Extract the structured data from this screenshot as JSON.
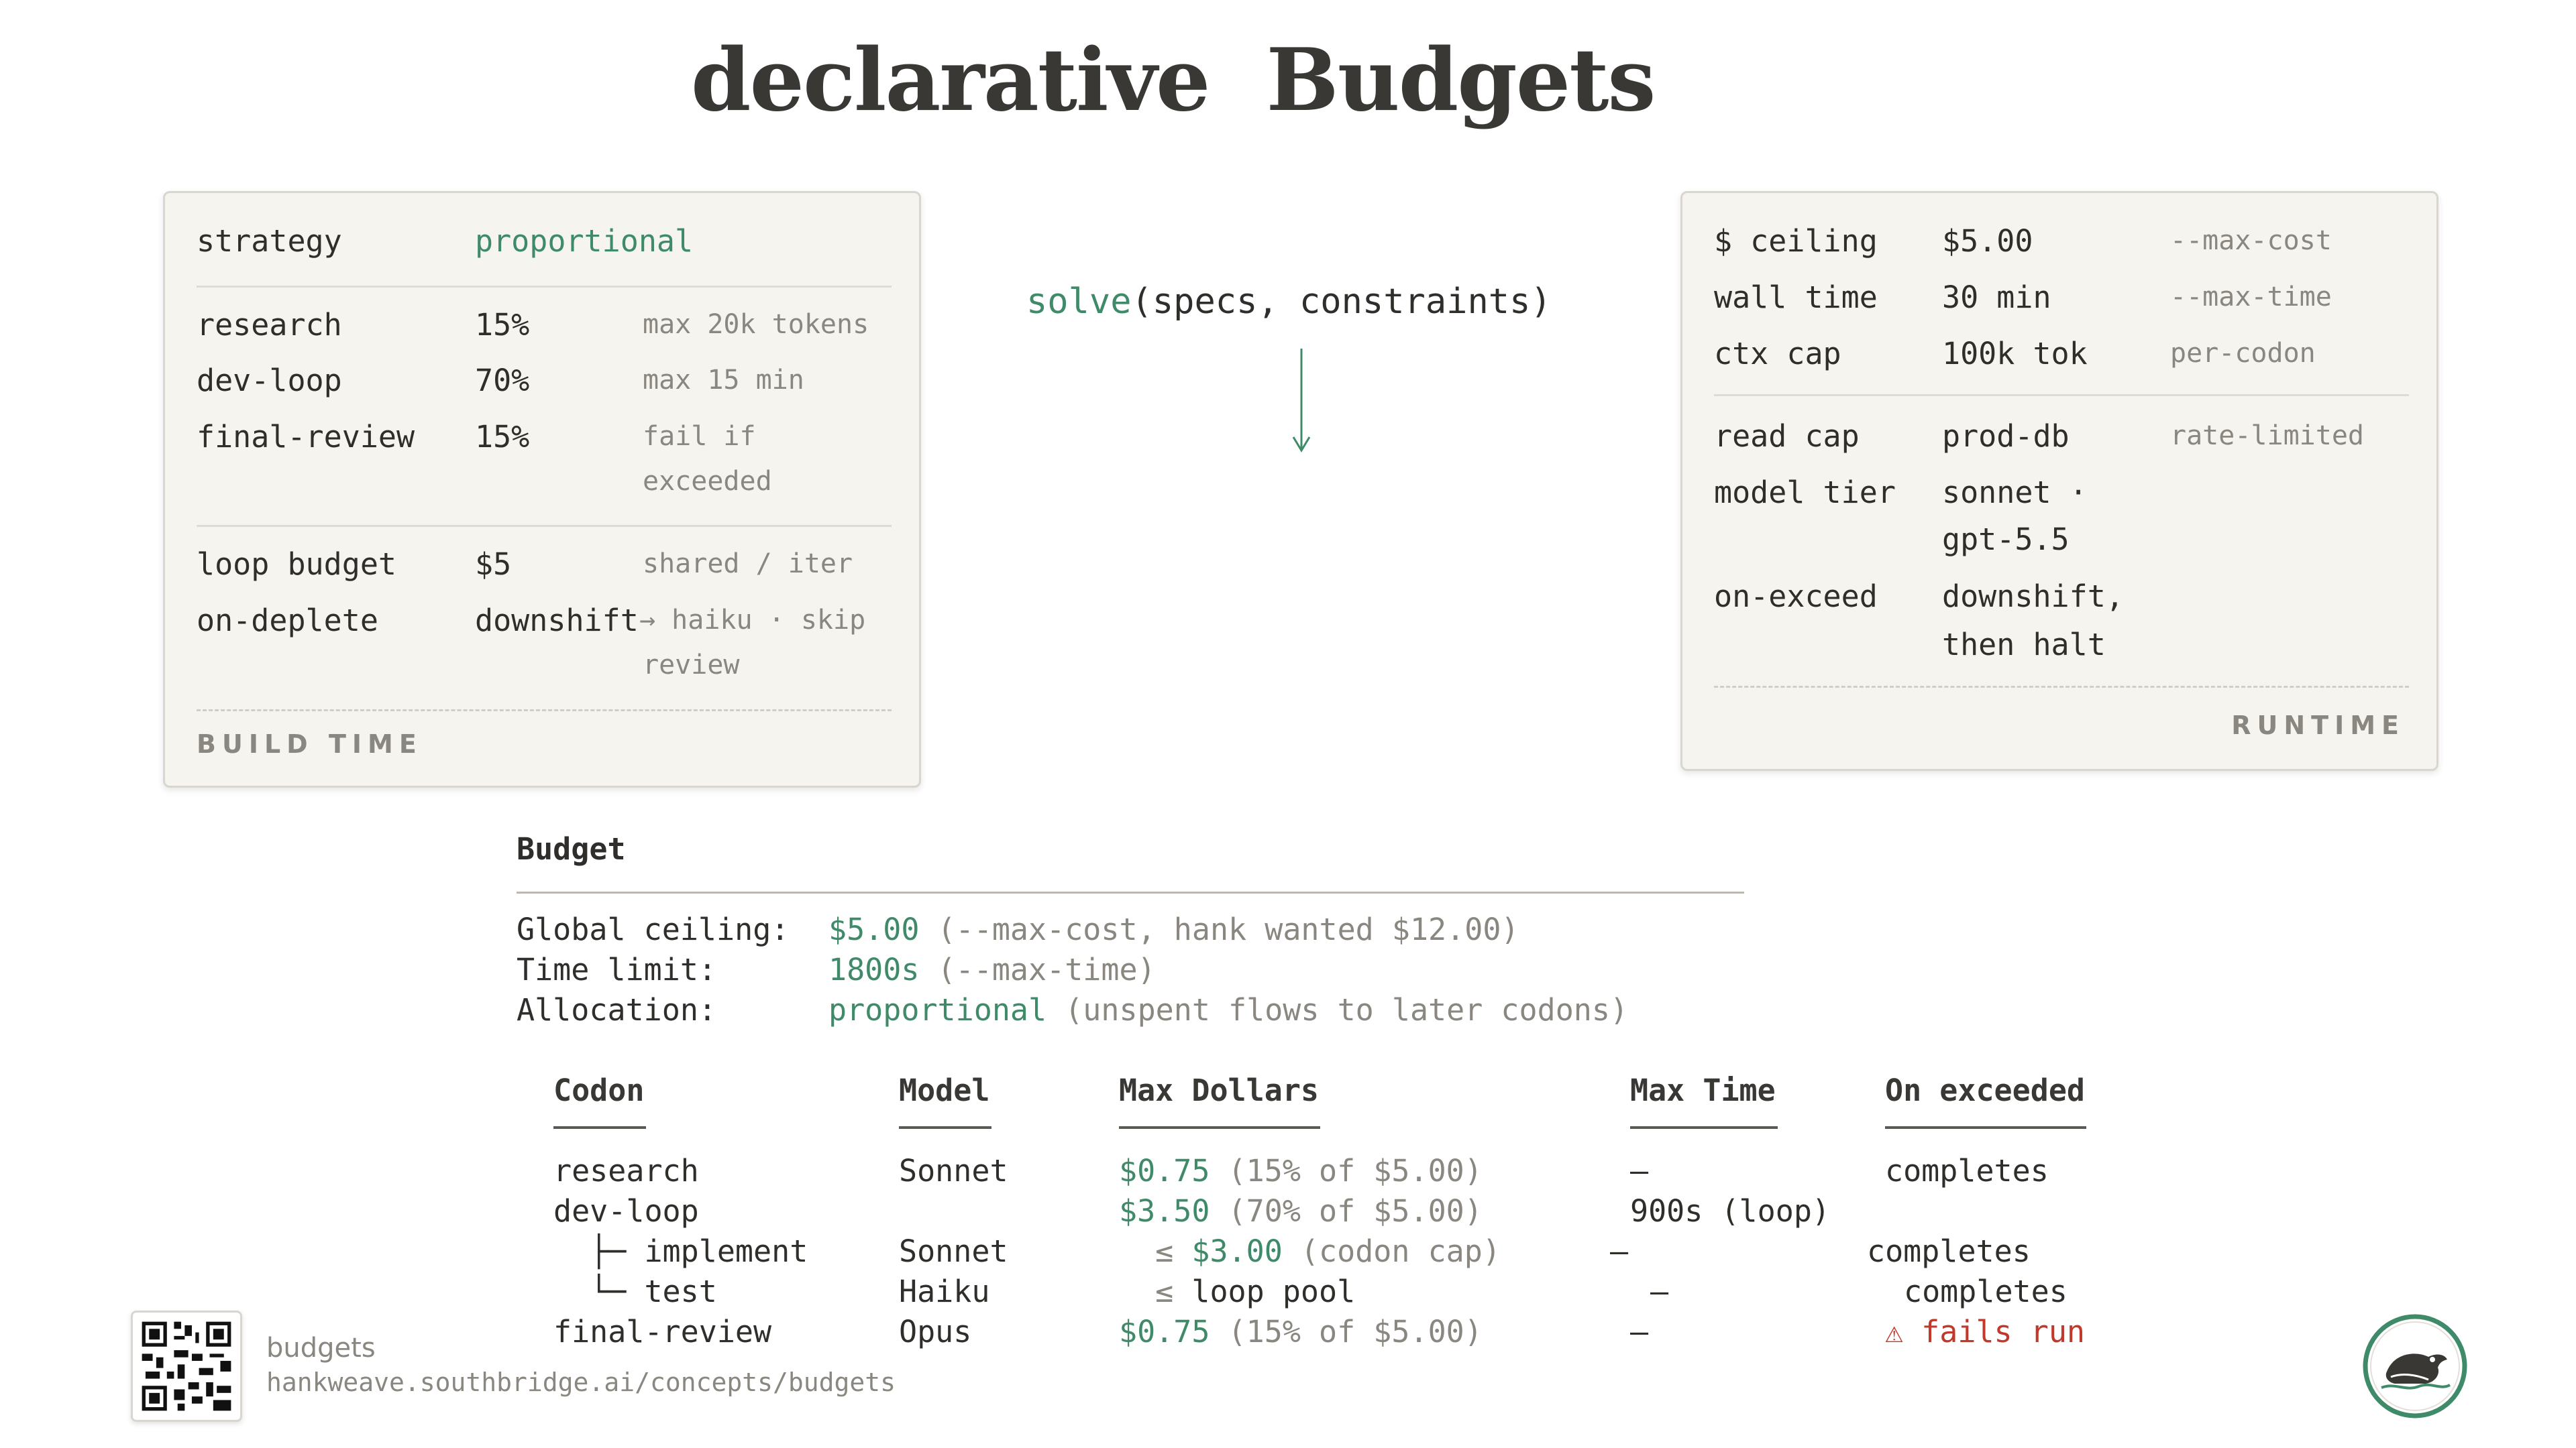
{
  "title": "declarative  Budgets",
  "build_panel": {
    "strategy_key": "strategy",
    "strategy_value": "proportional",
    "rows": [
      {
        "key": "research",
        "value": "15%",
        "note": "max 20k tokens"
      },
      {
        "key": "dev-loop",
        "value": "70%",
        "note": "max 15 min"
      },
      {
        "key": "final-review",
        "value": "15%",
        "note": "fail if",
        "note2": "exceeded"
      }
    ],
    "loop_budget": {
      "key": "loop budget",
      "value": "$5",
      "note": "shared / iter"
    },
    "on_deplete": {
      "key": "on-deplete",
      "value": "downshift",
      "note": "→ haiku · skip",
      "note2": "review"
    },
    "caption": "BUILD TIME"
  },
  "solve": {
    "fn": "solve",
    "args": "(specs, constraints)"
  },
  "runtime_panel": {
    "rows1": [
      {
        "key": "$ ceiling",
        "value": "$5.00",
        "note": "--max-cost"
      },
      {
        "key": "wall time",
        "value": "30 min",
        "note": "--max-time"
      },
      {
        "key": "ctx cap",
        "value": "100k tok",
        "note": "per-codon"
      }
    ],
    "read_cap": {
      "key": "read cap",
      "value": "prod-db",
      "note": "rate-limited"
    },
    "model_tier": {
      "key": "model tier",
      "value": "sonnet ·",
      "value2": "gpt-5.5"
    },
    "on_exceed": {
      "key": "on-exceed",
      "value": "downshift,",
      "value2": "then halt"
    },
    "caption": "RUNTIME"
  },
  "budget": {
    "heading": "Budget",
    "global_label": "Global ceiling:",
    "global_value": "$5.00",
    "global_note": " (--max-cost, hank wanted $12.00)",
    "time_label": "Time limit:",
    "time_value": "1800s",
    "time_note": " (--max-time)",
    "alloc_label": "Allocation:",
    "alloc_value": "proportional",
    "alloc_note": " (unspent flows to later codons)"
  },
  "table": {
    "headers": [
      "Codon",
      "Model",
      "Max Dollars",
      "Max Time",
      "On exceeded"
    ],
    "rows": [
      {
        "codon": "research",
        "model": "Sonnet",
        "dollars": "$0.75",
        "dollars_note": " (15% of $5.00)",
        "time": "—",
        "exceeded": "completes"
      },
      {
        "codon": "dev-loop",
        "model": "",
        "dollars": "$3.50",
        "dollars_note": " (70% of $5.00)",
        "time": "900s (loop)",
        "exceeded": ""
      },
      {
        "codon": "  ├─ implement",
        "model": "Sonnet",
        "dollars_prefix": "  ≤ ",
        "dollars": "$3.00",
        "dollars_note": " (codon cap)",
        "time": "—",
        "exceeded": "completes"
      },
      {
        "codon": "  └─ test",
        "model": "Haiku",
        "dollars_prefix": "  ≤ ",
        "dollars": "",
        "dollars_note": "loop pool",
        "time": "—",
        "exceeded": "completes"
      },
      {
        "codon": "final-review",
        "model": "Opus",
        "dollars": "$0.75",
        "dollars_note": " (15% of $5.00)",
        "time": "—",
        "exceeded": "⚠ fails run"
      }
    ]
  },
  "footer": {
    "name": "budgets",
    "url": "hankweave.southbridge.ai/concepts/budgets"
  }
}
